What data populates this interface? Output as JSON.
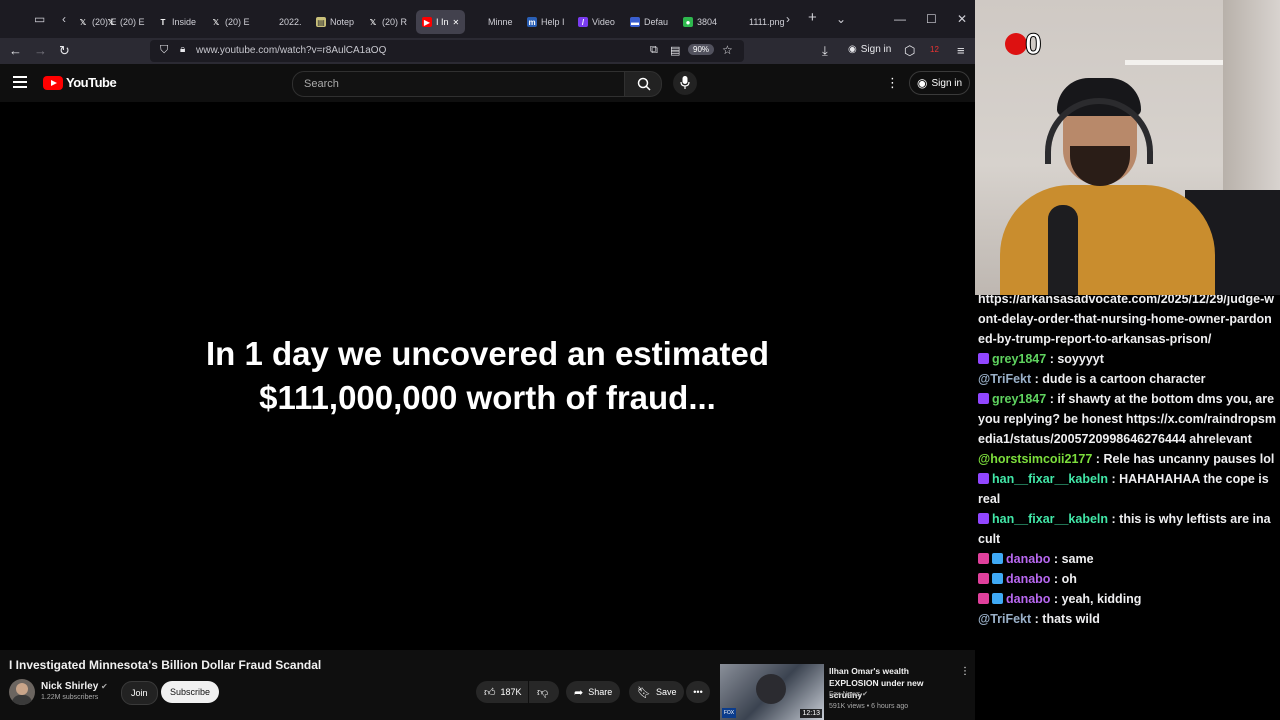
{
  "browser": {
    "tabs": [
      {
        "label": "(20) E",
        "icon": "x-icon"
      },
      {
        "label": "(20) E",
        "icon": "x-icon"
      },
      {
        "label": "Inside",
        "icon": "nyt-icon"
      },
      {
        "label": "(20) E",
        "icon": "x-icon"
      },
      {
        "label": "2022.",
        "icon": "blank-icon"
      },
      {
        "label": "Notep",
        "icon": "notepad-icon"
      },
      {
        "label": "(20) R",
        "icon": "x-icon"
      },
      {
        "label": "I In",
        "icon": "youtube-icon"
      },
      {
        "label": "Minne",
        "icon": "blank-icon"
      },
      {
        "label": "Help I",
        "icon": "m-icon"
      },
      {
        "label": "Video",
        "icon": "slash-icon"
      },
      {
        "label": "Defau",
        "icon": "blue-icon"
      },
      {
        "label": "3804",
        "icon": "maps-icon"
      },
      {
        "label": "1111.png",
        "icon": "blank-icon"
      }
    ],
    "url": "www.youtube.com/watch?v=r8AulCA1aOQ",
    "zoom": "90%",
    "signin": "Sign in",
    "badge_count": "12"
  },
  "youtube": {
    "logo": "YouTube",
    "search_placeholder": "Search",
    "signin": "Sign in",
    "caption_line1": "In 1 day we uncovered an estimated",
    "caption_line2": "$111,000,000 worth of fraud...",
    "video_title": "I Investigated Minnesota's Billion Dollar Fraud Scandal",
    "channel": "Nick Shirley",
    "subscribers": "1.22M subscribers",
    "join": "Join",
    "subscribe": "Subscribe",
    "likes": "187K",
    "share": "Share",
    "save": "Save",
    "reco": {
      "title": "Ilhan Omar's wealth EXPLOSION under new scrutiny",
      "channel": "Fox News",
      "meta": "591K views • 6 hours ago",
      "duration": "12:13",
      "badge": "FOX NEWS"
    }
  },
  "stream": {
    "overlay_count": "0"
  },
  "chat": [
    {
      "user": "",
      "text": "https://arkansasadvocate.com/2025/12/29/judge-wont-delay-order-that-nursing-home-owner-pardoned-by-trump-report-to-arkansas-prison/",
      "color": "#efeff1",
      "badges": []
    },
    {
      "user": "grey1847",
      "text": "soyyyyt",
      "color": "#5fd35f",
      "badges": [
        "#9146ff"
      ]
    },
    {
      "user": "@TriFekt",
      "text": "dude is a cartoon character",
      "color": "#9ab0c8",
      "badges": []
    },
    {
      "user": "grey1847",
      "text": "if shawty at the bottom dms you, are you replying? be honest https://x.com/raindropsmedia1/status/2005720998646276444 ahrelevant",
      "color": "#5fd35f",
      "badges": [
        "#9146ff"
      ]
    },
    {
      "user": "@horstsimcoii2177",
      "text": "Rele has uncanny pauses lol",
      "color": "#7cde3c",
      "badges": []
    },
    {
      "user": "han__fixar__kabeln",
      "text": "HAHAHAHAA the cope is real",
      "color": "#42e8a8",
      "badges": [
        "#9146ff"
      ]
    },
    {
      "user": "han__fixar__kabeln",
      "text": "this is why leftists are ina cult",
      "color": "#42e8a8",
      "badges": [
        "#9146ff"
      ]
    },
    {
      "user": "danabo",
      "text": "same",
      "color": "#b868f0",
      "badges": [
        "#e0409c",
        "#3fa9f5"
      ]
    },
    {
      "user": "danabo",
      "text": "oh",
      "color": "#b868f0",
      "badges": [
        "#e0409c",
        "#3fa9f5"
      ]
    },
    {
      "user": "danabo",
      "text": "yeah, kidding",
      "color": "#b868f0",
      "badges": [
        "#e0409c",
        "#3fa9f5"
      ]
    },
    {
      "user": "@TriFekt",
      "text": "thats wild",
      "color": "#9ab0c8",
      "badges": []
    }
  ]
}
